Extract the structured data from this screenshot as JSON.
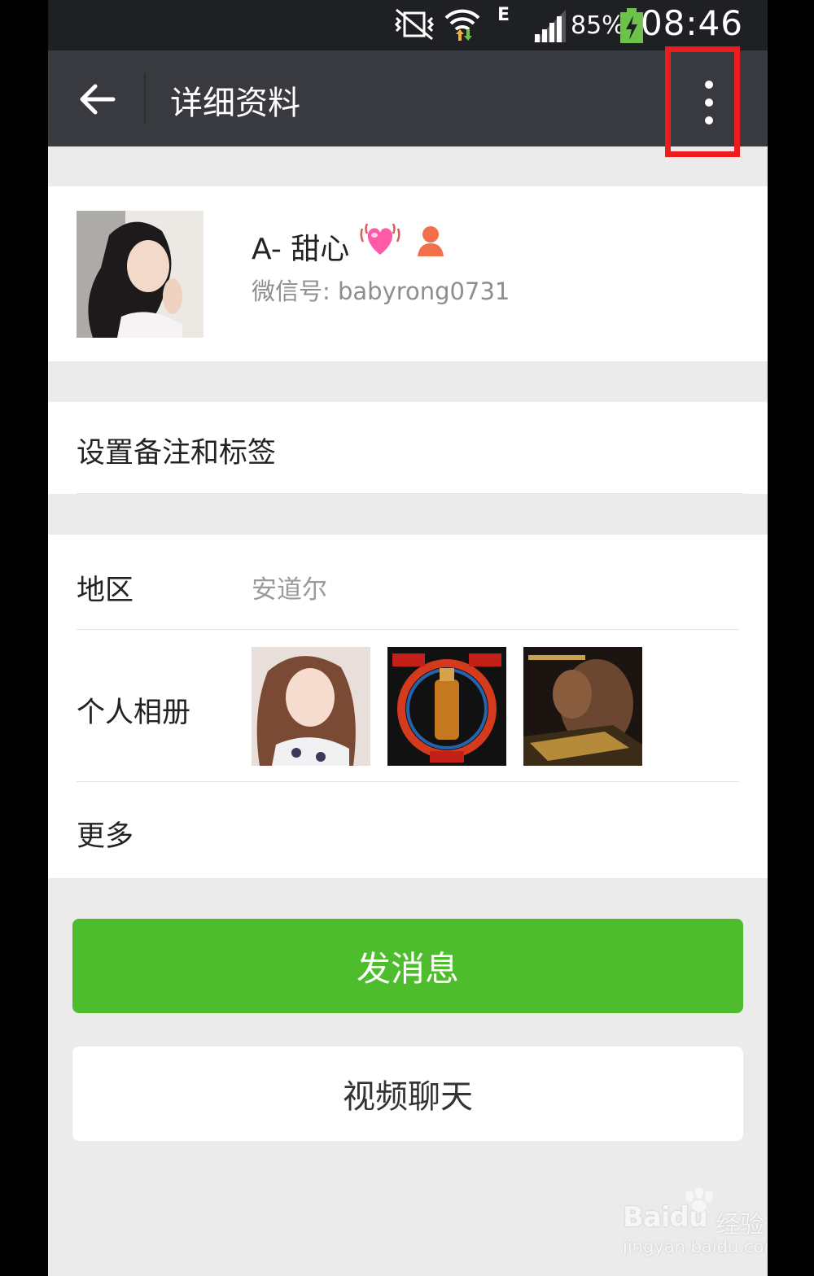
{
  "status_bar": {
    "battery": "85%",
    "network": "E",
    "time": "08:46"
  },
  "toolbar": {
    "title": "详细资料",
    "back_icon": "arrow-left-icon",
    "more_icon": "more-vertical-icon"
  },
  "profile": {
    "nickname": "A- 甜心",
    "wechat_id": "微信号: babyrong0731"
  },
  "remark": {
    "label": "设置备注和标签"
  },
  "info": {
    "region_label": "地区",
    "region_value": "安道尔",
    "album_label": "个人相册",
    "more_label": "更多"
  },
  "actions": {
    "send_message": "发消息",
    "video_chat": "视频聊天"
  },
  "colors": {
    "toolbar_bg": "#393a3f",
    "primary_green": "#4ebd2d",
    "highlight_red": "#ee1c1c"
  },
  "watermark": {
    "brand": "Bai",
    "brand_suffix": "du",
    "cn": "经验",
    "url": "jingyan.baidu.com"
  }
}
